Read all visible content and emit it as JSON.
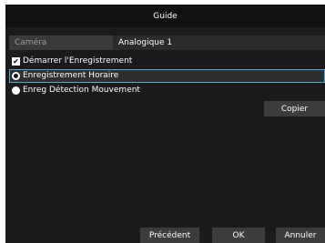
{
  "window": {
    "title": "Guide"
  },
  "camera": {
    "label": "Caméra",
    "value": "Analogique 1"
  },
  "options": {
    "start_recording": {
      "label": "Démarrer l'Enregistrement",
      "checked": true
    },
    "schedule": {
      "label": "Enregistrement Horaire",
      "selected": true
    },
    "motion": {
      "label": "Enreg Détection Mouvement",
      "selected": false
    }
  },
  "buttons": {
    "copy": "Copier",
    "previous": "Précédent",
    "ok": "OK",
    "cancel": "Annuler"
  },
  "icons": {
    "checkbox": "check-icon",
    "radio": "radio-icon"
  }
}
